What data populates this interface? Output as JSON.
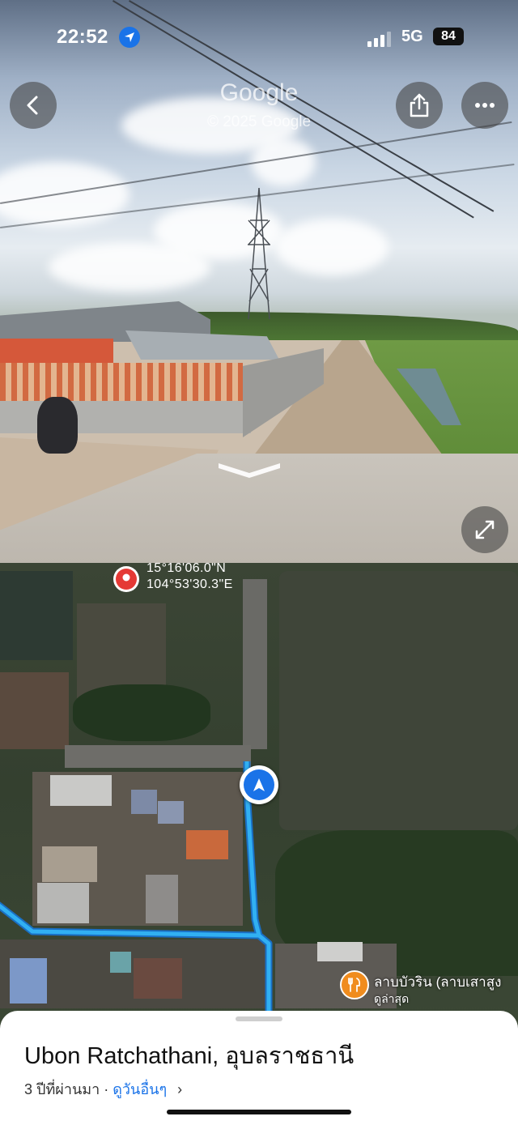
{
  "status_bar": {
    "time": "22:52",
    "network": "5G",
    "battery": "84"
  },
  "street_view": {
    "watermark_brand": "Google",
    "watermark_copyright": "© 2025 Google",
    "buttons": {
      "back": "back-icon",
      "share": "share-icon",
      "more": "more-icon",
      "expand": "expand-icon"
    }
  },
  "map": {
    "coordinate_lat": "15°16'06.0\"N",
    "coordinate_lng": "104°53'30.3\"E",
    "poi_name": "ลาบบัวริน (ลาบเสาสูง",
    "poi_subtitle": "ดูล่าสุด",
    "route_color": "#31b0f2"
  },
  "sheet": {
    "title": "Ubon Ratchathani, อุบลราชธานี",
    "age": "3 ปีที่ผ่านมา",
    "separator": " · ",
    "see_more": "ดูวันอื่นๆ",
    "chevron": "›"
  },
  "colors": {
    "accent": "#1a73e8",
    "poi": "#f08c1e",
    "pin": "#e53935"
  }
}
